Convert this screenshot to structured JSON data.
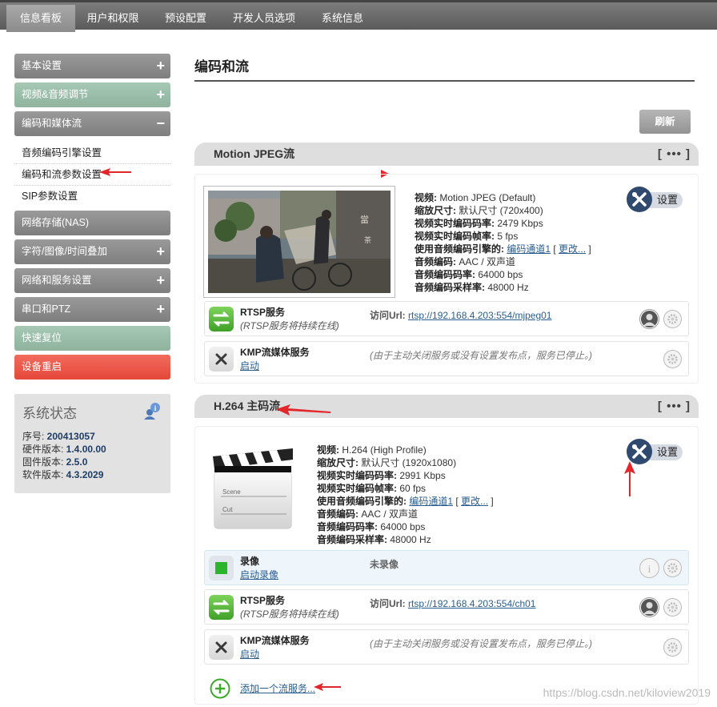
{
  "tabs": [
    {
      "label": "信息看板"
    },
    {
      "label": "用户和权限"
    },
    {
      "label": "预设配置"
    },
    {
      "label": "开发人员选项"
    },
    {
      "label": "系统信息"
    }
  ],
  "sidebar": {
    "items": [
      {
        "label": "基本设置",
        "toggle": "+"
      },
      {
        "label": "视频&音频调节",
        "toggle": "+"
      },
      {
        "label": "编码和媒体流",
        "toggle": "−"
      },
      {
        "label": "网络存储(NAS)"
      },
      {
        "label": "字符/图像/时间叠加",
        "toggle": "+"
      },
      {
        "label": "网络和服务设置",
        "toggle": "+"
      },
      {
        "label": "串口和PTZ",
        "toggle": "+"
      },
      {
        "label": "快速复位"
      },
      {
        "label": "设备重启"
      }
    ],
    "subitems": [
      {
        "label": "音频编码引擎设置"
      },
      {
        "label": "编码和流参数设置"
      },
      {
        "label": "SIP参数设置"
      }
    ]
  },
  "status": {
    "title": "系统状态",
    "rows": [
      {
        "label": "序号: ",
        "value": "200413057"
      },
      {
        "label": "硬件版本: ",
        "value": "1.4.00.00"
      },
      {
        "label": "固件版本: ",
        "value": "2.5.0"
      },
      {
        "label": "软件版本: ",
        "value": "4.3.2029"
      }
    ]
  },
  "main": {
    "title": "编码和流",
    "refresh": "刷新",
    "more": "[ ••• ]",
    "settings": "设置"
  },
  "mjpeg": {
    "name": "Motion JPEG流",
    "meta": [
      {
        "k": "视频: ",
        "v": "Motion JPEG (Default)"
      },
      {
        "k": "缩放尺寸: ",
        "v": "默认尺寸 (720x400)"
      },
      {
        "k": "视频实时编码码率: ",
        "v": "2479 Kbps"
      },
      {
        "k": "视频实时编码帧率: ",
        "v": "5 fps"
      },
      {
        "k": "使用音频编码引擎的: ",
        "link": "编码通道1",
        "change": "更改..."
      },
      {
        "k": "音频编码: ",
        "v": "AAC / 双声道"
      },
      {
        "k": "音频编码码率: ",
        "v": "64000 bps"
      },
      {
        "k": "音频编码采样率: ",
        "v": "48000 Hz"
      }
    ],
    "rtsp": {
      "name": "RTSP服务",
      "sub": "(RTSP服务将持续在线)",
      "url_label": "访问Url: ",
      "url": "rtsp://192.168.4.203:554/mjpeg01"
    },
    "kmp": {
      "name": "KMP流媒体服务",
      "sub": "启动",
      "note": "(由于主动关闭服务或没有设置发布点，服务已停止。)"
    }
  },
  "h264": {
    "name": "H.264 主码流",
    "meta": [
      {
        "k": "视频: ",
        "v": "H.264 (High Profile)"
      },
      {
        "k": "缩放尺寸: ",
        "v": "默认尺寸 (1920x1080)"
      },
      {
        "k": "视频实时编码码率: ",
        "v": "2991 Kbps"
      },
      {
        "k": "视频实时编码帧率: ",
        "v": "60 fps"
      },
      {
        "k": "使用音频编码引擎的: ",
        "link": "编码通道1",
        "change": "更改..."
      },
      {
        "k": "音频编码: ",
        "v": "AAC / 双声道"
      },
      {
        "k": "音频编码码率: ",
        "v": "64000 bps"
      },
      {
        "k": "音频编码采样率: ",
        "v": "48000 Hz"
      }
    ],
    "record": {
      "name": "录像",
      "sub": "启动录像",
      "status": "未录像"
    },
    "rtsp": {
      "name": "RTSP服务",
      "sub": "(RTSP服务将持续在线)",
      "url_label": "访问Url: ",
      "url": "rtsp://192.168.4.203:554/ch01"
    },
    "kmp": {
      "name": "KMP流媒体服务",
      "sub": "启动",
      "note": "(由于主动关闭服务或没有设置发布点，服务已停止。)"
    }
  },
  "clapper": {
    "scene": "Scene",
    "cut": "Cut"
  },
  "add_stream": "添加一个流服务...",
  "watermark": "https://blog.csdn.net/kiloview2019",
  "colors": {
    "accent_red": "#e4483a",
    "nav_active": "#8c8c8c",
    "arrow": "#e3262a"
  }
}
